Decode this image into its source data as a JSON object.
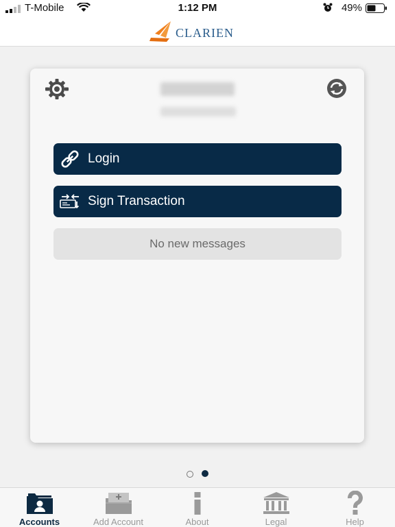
{
  "status": {
    "carrier": "T-Mobile",
    "time": "1:12 PM",
    "battery": "49%"
  },
  "header": {
    "logo_text": "CLARIEN"
  },
  "card": {
    "login_label": "Login",
    "sign_label": "Sign Transaction",
    "messages_label": "No new messages"
  },
  "pager": {
    "page_count": 2,
    "current_page": 2
  },
  "tabs": [
    {
      "label": "Accounts",
      "icon": "folder-user-icon",
      "active": true
    },
    {
      "label": "Add Account",
      "icon": "folder-add-icon",
      "active": false
    },
    {
      "label": "About",
      "icon": "info-icon",
      "active": false
    },
    {
      "label": "Legal",
      "icon": "bank-icon",
      "active": false
    },
    {
      "label": "Help",
      "icon": "question-icon",
      "active": false
    }
  ],
  "colors": {
    "primary": "#082a47",
    "logo_orange": "#f0801e",
    "logo_blue": "#2b5d8c",
    "tab_active": "#0d2a42",
    "tab_inactive": "#9a9a9a"
  }
}
